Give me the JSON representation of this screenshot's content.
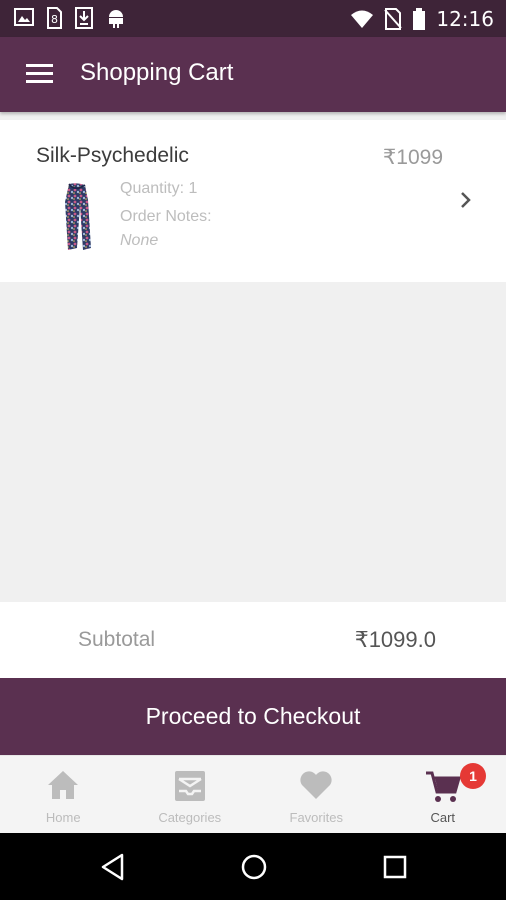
{
  "status_bar": {
    "time": "12:16",
    "left_icons": [
      "image-icon",
      "sim-download-icon",
      "download-icon",
      "android-icon"
    ],
    "right_icons": [
      "wifi-icon",
      "no-sim-icon",
      "battery-icon"
    ]
  },
  "app_bar": {
    "menu_icon": "hamburger-menu-icon",
    "title": "Shopping Cart"
  },
  "cart": {
    "items": [
      {
        "name": "Silk-Psychedelic",
        "price": "₹1099",
        "quantity": "Quantity: 1",
        "notes_label": "Order Notes:",
        "notes_value": "None",
        "thumbnail": "scarf-thumbnail",
        "action_icon": "chevron-right-icon"
      }
    ]
  },
  "summary": {
    "subtotal_label": "Subtotal",
    "subtotal_value": "₹1099.0"
  },
  "checkout": {
    "label": "Proceed to Checkout"
  },
  "bottom_nav": {
    "items": [
      {
        "label": "Home",
        "icon": "home-icon"
      },
      {
        "label": "Categories",
        "icon": "categories-icon"
      },
      {
        "label": "Favorites",
        "icon": "heart-icon"
      },
      {
        "label": "Cart",
        "icon": "cart-icon",
        "active": true
      }
    ],
    "cart_badge": "1"
  },
  "system_nav": {
    "icons": [
      "back-icon",
      "home-circle-icon",
      "recents-icon"
    ]
  },
  "colors": {
    "primary": "#5a3050",
    "status_bar": "#3e2438",
    "badge": "#e53935",
    "background": "#f0f0f0"
  }
}
